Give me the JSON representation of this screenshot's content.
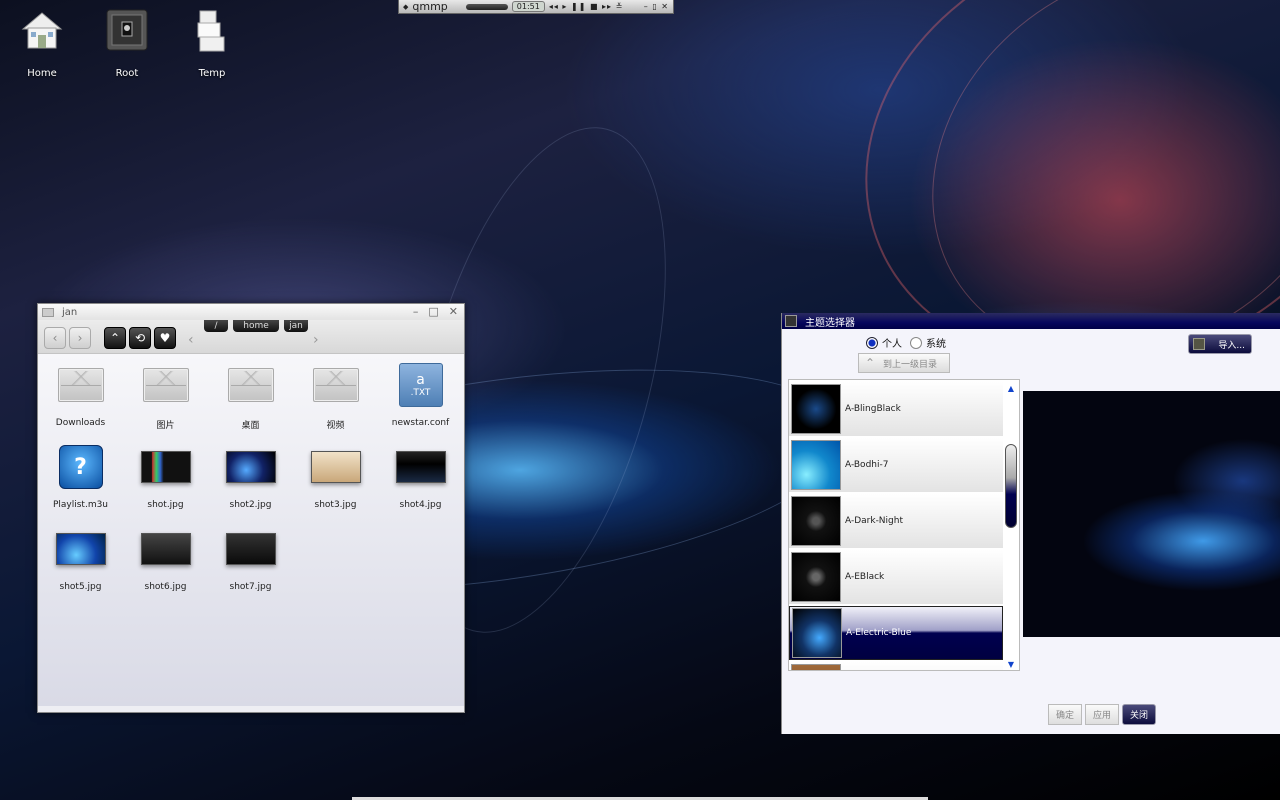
{
  "desktop": {
    "icons": [
      {
        "label": "Home",
        "icon": "house-icon"
      },
      {
        "label": "Root",
        "icon": "safe-icon"
      },
      {
        "label": "Temp",
        "icon": "boxes-icon"
      }
    ]
  },
  "qmmp": {
    "title": "qmmp",
    "time": "01:51",
    "controls": "◂◂ ▸ ❚❚ ■ ▸▸ ≚",
    "window_buttons": "– ▯ ✕"
  },
  "file_manager": {
    "title": "jan",
    "window_buttons": {
      "minimize": "–",
      "maximize": "□",
      "close": "✕"
    },
    "toolbar": {
      "back": "‹",
      "forward": "›",
      "up": "⌃",
      "refresh": "⟲",
      "favorite": "♥"
    },
    "breadcrumbs": [
      "/",
      "home",
      "jan"
    ],
    "files": [
      {
        "name": "Downloads",
        "kind": "folder"
      },
      {
        "name": "图片",
        "kind": "folder"
      },
      {
        "name": "桌面",
        "kind": "folder"
      },
      {
        "name": "视频",
        "kind": "folder"
      },
      {
        "name": "newstar.conf",
        "kind": "text"
      },
      {
        "name": "Playlist.m3u",
        "kind": "playlist"
      },
      {
        "name": "shot.jpg",
        "kind": "image"
      },
      {
        "name": "shot2.jpg",
        "kind": "image"
      },
      {
        "name": "shot3.jpg",
        "kind": "image"
      },
      {
        "name": "shot4.jpg",
        "kind": "image"
      },
      {
        "name": "shot5.jpg",
        "kind": "image"
      },
      {
        "name": "shot6.jpg",
        "kind": "image"
      },
      {
        "name": "shot7.jpg",
        "kind": "image"
      }
    ],
    "text_icon": {
      "letter": "a",
      "ext": ".TXT"
    },
    "playlist_glyph": "?"
  },
  "theme_selector": {
    "title": "主题选择器",
    "radio_personal": "个人",
    "radio_system": "系统",
    "up_button": "到上一级目录",
    "import_button": "导入...",
    "themes": [
      {
        "name": "A-BlingBlack",
        "selected": false
      },
      {
        "name": "A-Bodhi-7",
        "selected": false
      },
      {
        "name": "A-Dark-Night",
        "selected": false
      },
      {
        "name": "A-EBlack",
        "selected": false
      },
      {
        "name": "A-Electric-Blue",
        "selected": true
      }
    ],
    "buttons": {
      "ok": "确定",
      "apply": "应用",
      "close": "关闭"
    },
    "scroll_up": "▲",
    "scroll_down": "▼"
  }
}
